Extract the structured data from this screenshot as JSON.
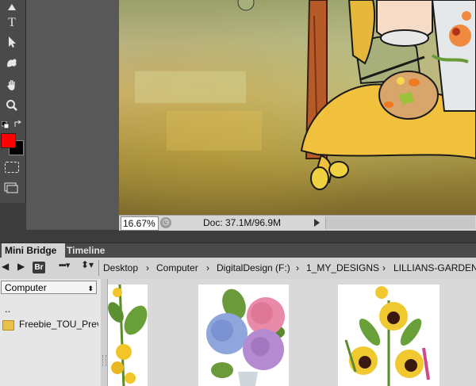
{
  "tools": {
    "items": [
      {
        "name": "type-tool",
        "icon": "type-icon"
      },
      {
        "name": "path-select-tool",
        "icon": "arrow-icon"
      },
      {
        "name": "custom-shape-tool",
        "icon": "shape-icon"
      },
      {
        "name": "hand-tool",
        "icon": "hand-icon"
      },
      {
        "name": "zoom-tool",
        "icon": "zoom-icon"
      }
    ],
    "type_glyph": "T",
    "foreground_color": "#ff0000",
    "background_color": "#000000"
  },
  "status": {
    "zoom": "16.67%",
    "doc_info": "Doc: 37.1M/96.9M"
  },
  "panel_tabs": {
    "mini_bridge": "Mini Bridge",
    "timeline": "Timeline"
  },
  "mini_bridge": {
    "br_label": "Br",
    "breadcrumbs": [
      "Desktop",
      "Computer",
      "DigitalDesign (F:)",
      "1_MY_DESIGNS",
      "LILLIANS-GARDEN"
    ],
    "location_select": "Computer",
    "parent_entry": "..",
    "folder_item": "Freebie_TOU_Preview"
  }
}
